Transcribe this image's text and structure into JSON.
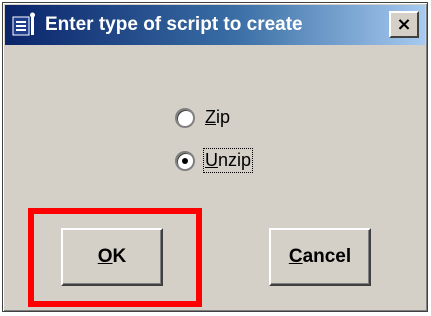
{
  "window": {
    "title": "Enter type of script to create",
    "close_glyph": "×"
  },
  "options": [
    {
      "label": "Zip",
      "mnemonic": "Z",
      "rest": "ip",
      "selected": false
    },
    {
      "label": "Unzip",
      "mnemonic": "U",
      "rest": "nzip",
      "selected": true
    }
  ],
  "buttons": {
    "ok": {
      "label": "OK",
      "mnemonic": "O",
      "rest": "K"
    },
    "cancel": {
      "label": "Cancel",
      "mnemonic": "C",
      "rest": "ancel"
    }
  },
  "annotation": {
    "highlight_color": "#ff0000",
    "highlights": "ok-button"
  },
  "colors": {
    "titlebar_start": "#0a246a",
    "titlebar_end": "#a6caf0",
    "dialog_bg": "#d4d0c8"
  }
}
